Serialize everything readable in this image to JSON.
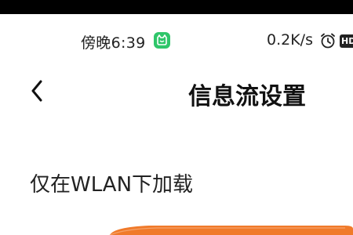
{
  "status_bar": {
    "time": "傍晚6:39",
    "net_speed": "0.2K/s",
    "hd_label": "HD",
    "app_icon": "cat-app-icon",
    "alarm_icon": "alarm-clock-icon",
    "app_icon_color": "#2fc66a"
  },
  "nav": {
    "back_icon": "chevron-left-icon",
    "title": "信息流设置"
  },
  "settings": {
    "wlan_only_label": "仅在WLAN下加载",
    "accent_color": "#f07a2a"
  }
}
